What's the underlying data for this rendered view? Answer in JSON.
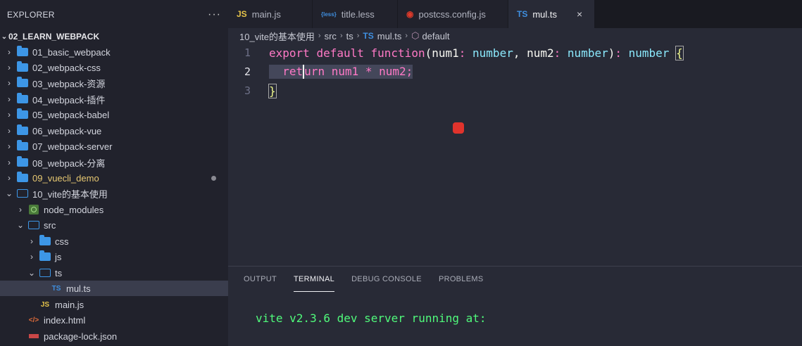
{
  "sidebar": {
    "title": "EXPLORER",
    "more": "···",
    "root": "02_LEARN_WEBPACK",
    "items": [
      {
        "label": "01_basic_webpack"
      },
      {
        "label": "02_webpack-css"
      },
      {
        "label": "03_webpack-资源"
      },
      {
        "label": "04_webpack-插件"
      },
      {
        "label": "05_webpack-babel"
      },
      {
        "label": "06_webpack-vue"
      },
      {
        "label": "07_webpack-server"
      },
      {
        "label": "08_webpack-分离"
      },
      {
        "label": "09_vuecli_demo"
      },
      {
        "label": "10_vite的基本使用"
      },
      {
        "label": "node_modules"
      },
      {
        "label": "src"
      },
      {
        "label": "css"
      },
      {
        "label": "js"
      },
      {
        "label": "ts"
      },
      {
        "label": "mul.ts"
      },
      {
        "label": "main.js"
      },
      {
        "label": "index.html"
      },
      {
        "label": "package-lock.json"
      }
    ]
  },
  "tabs": [
    {
      "icon": "JS",
      "label": "main.js"
    },
    {
      "icon": "{less}",
      "label": "title.less"
    },
    {
      "icon": "postcss",
      "label": "postcss.config.js"
    },
    {
      "icon": "TS",
      "label": "mul.ts",
      "close": "×"
    }
  ],
  "breadcrumb": {
    "parts": [
      "10_vite的基本使用",
      "src",
      "ts",
      "mul.ts",
      "default"
    ],
    "ts_icon": "TS"
  },
  "editor": {
    "lines": [
      {
        "num": "1"
      },
      {
        "num": "2"
      },
      {
        "num": "3"
      }
    ],
    "tokens": {
      "export": "export",
      "default": "default",
      "function": "function",
      "open": "(",
      "p1": "num1",
      "c1": ":",
      "t1": "number",
      "comma": ",",
      "p2": "num2",
      "c2": ":",
      "t2": "number",
      "close": ")",
      "c3": ":",
      "t3": "number",
      "brace_open": "{",
      "ret_a": "ret",
      "ret_b": "urn",
      "body": "num1 * num2;",
      "brace_close": "}"
    }
  },
  "panel": {
    "tabs": [
      "OUTPUT",
      "TERMINAL",
      "DEBUG CONSOLE",
      "PROBLEMS"
    ],
    "active": "TERMINAL",
    "terminal_text": "vite v2.3.6 dev server running at:"
  },
  "colors": {
    "keyword": "#ff79c6",
    "function": "#50fa7b",
    "type": "#8be9fd",
    "folder": "#3d96e6"
  }
}
